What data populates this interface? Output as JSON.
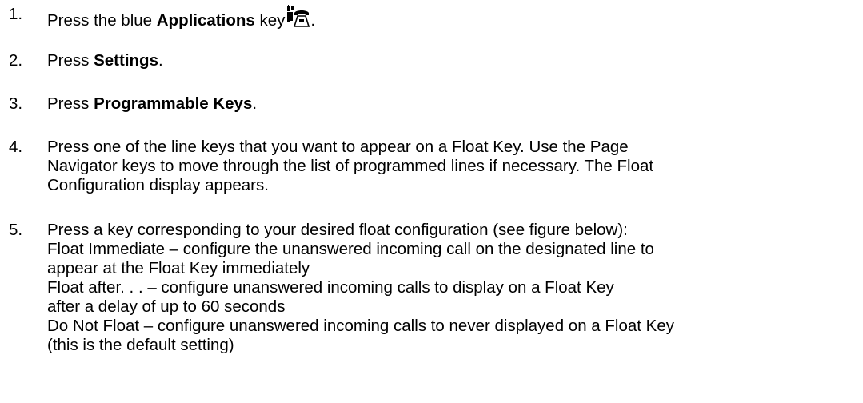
{
  "steps": [
    {
      "number": "1.",
      "pre": "Press the blue ",
      "bold": "Applications",
      "post": " key",
      "icon": "applications-key-icon",
      "end": "."
    },
    {
      "number": "2.",
      "pre": "Press ",
      "bold": "Settings",
      "post": "."
    },
    {
      "number": "3.",
      "pre": "Press ",
      "bold": "Programmable Keys",
      "post": "."
    },
    {
      "number": "4.",
      "lines": [
        "Press one of the line keys that you want to appear on a Float Key. Use the Page",
        "Navigator keys to move through the list of programmed lines if necessary. The Float",
        "Configuration display appears."
      ]
    },
    {
      "number": "5.",
      "lines": [
        "Press a key corresponding to your desired float configuration (see figure below):",
        "Float Immediate – configure the unanswered incoming call on the designated line to",
        "appear at the Float Key immediately",
        "Float after. . . – configure unanswered incoming calls to display on a Float Key",
        "after a delay of up to 60 seconds",
        "Do Not Float – configure unanswered incoming calls to never displayed on a Float Key",
        "(this is the default setting)"
      ]
    }
  ]
}
